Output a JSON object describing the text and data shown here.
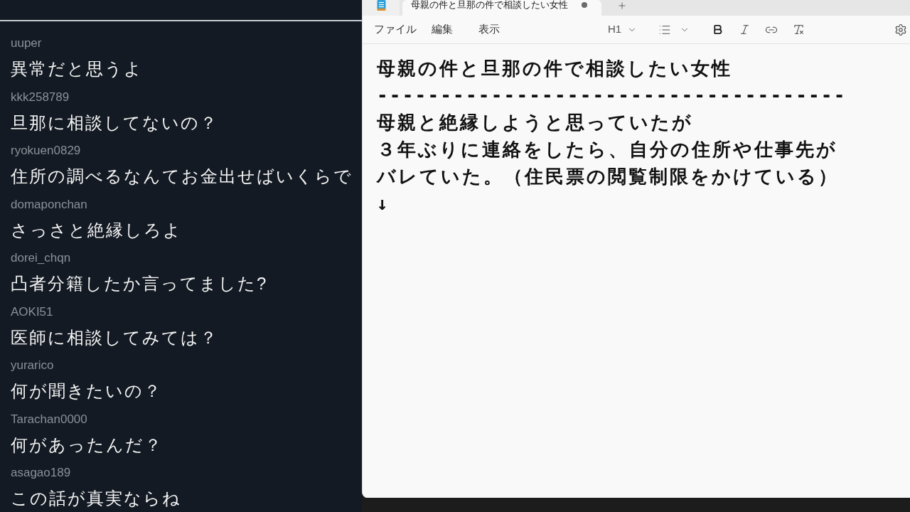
{
  "chat": {
    "comments": [
      {
        "user": "uuper",
        "text": "異常だと思うよ"
      },
      {
        "user": "kkk258789",
        "text": "旦那に相談してないの？"
      },
      {
        "user": "ryokuen0829",
        "text": "住所の調べるなんてお金出せばいくらで"
      },
      {
        "user": "domaponchan",
        "text": "さっさと絶縁しろよ"
      },
      {
        "user": "dorei_chqn",
        "text": "凸者分籍したか言ってました?"
      },
      {
        "user": "AOKI51",
        "text": "医師に相談してみては？"
      },
      {
        "user": "yurarico",
        "text": "何が聞きたいの？"
      },
      {
        "user": "Tarachan0000",
        "text": "何があったんだ？"
      },
      {
        "user": "asagao189",
        "text": "この話が真実ならね"
      }
    ]
  },
  "notepad": {
    "tabs": [
      {
        "title": "母親の件と旦那の件で相談したい女性",
        "selected": true,
        "unsaved": true
      }
    ],
    "menu": [
      "ファイル",
      "編集",
      "表示"
    ],
    "heading_level": "H1",
    "lines": [
      {
        "kind": "text",
        "text": "母親の件と旦那の件で相談したい女性"
      },
      {
        "kind": "rule",
        "text": "-------------------------------------"
      },
      {
        "kind": "text",
        "text": "母親と絶縁しようと思っていたが"
      },
      {
        "kind": "text",
        "text": "３年ぶりに連絡をしたら、自分の住所や仕事先が"
      },
      {
        "kind": "text",
        "text": "バレていた。（住民票の閲覧制限をかけている）"
      },
      {
        "kind": "text",
        "text": "↓"
      }
    ]
  }
}
